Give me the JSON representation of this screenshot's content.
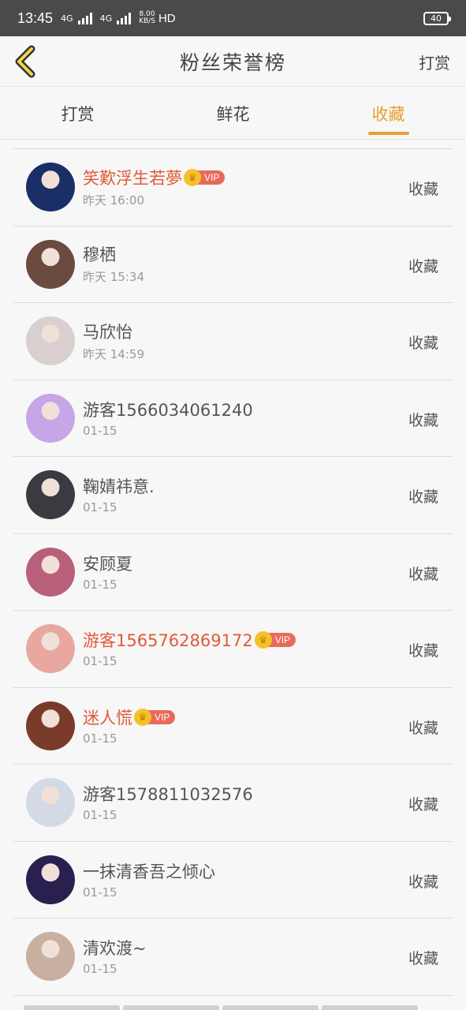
{
  "status_bar": {
    "time": "13:45",
    "network_1": "4G",
    "network_2": "4G",
    "speed_value": "8.00",
    "speed_unit": "KB/S",
    "hd": "HD",
    "battery": "40"
  },
  "nav": {
    "title": "粉丝荣誉榜",
    "right_label": "打赏"
  },
  "tabs": [
    {
      "label": "打赏",
      "active": false
    },
    {
      "label": "鲜花",
      "active": false
    },
    {
      "label": "收藏",
      "active": true
    }
  ],
  "vip_label": "VIP",
  "fans": [
    {
      "name": "笑歎浮生若夢",
      "time": "昨天 16:00",
      "action": "收藏",
      "vip": true,
      "avatar_color": "#1a2f66"
    },
    {
      "name": "穆栖",
      "time": "昨天 15:34",
      "action": "收藏",
      "vip": false,
      "avatar_color": "#6b4a40"
    },
    {
      "name": "马欣怡",
      "time": "昨天 14:59",
      "action": "收藏",
      "vip": false,
      "avatar_color": "#d9cfcf"
    },
    {
      "name": "游客1566034061240",
      "time": "01-15",
      "action": "收藏",
      "vip": false,
      "avatar_color": "#c6a6e6"
    },
    {
      "name": "鞠婧祎意.",
      "time": "01-15",
      "action": "收藏",
      "vip": false,
      "avatar_color": "#3a3a40"
    },
    {
      "name": "安顾夏",
      "time": "01-15",
      "action": "收藏",
      "vip": false,
      "avatar_color": "#b8607a"
    },
    {
      "name": "游客1565762869172",
      "time": "01-15",
      "action": "收藏",
      "vip": true,
      "avatar_color": "#e8a8a0"
    },
    {
      "name": "迷人慌",
      "time": "01-15",
      "action": "收藏",
      "vip": true,
      "avatar_color": "#7a3a2a"
    },
    {
      "name": "游客1578811032576",
      "time": "01-15",
      "action": "收藏",
      "vip": false,
      "avatar_color": "#d4d9e6"
    },
    {
      "name": "一抹清香吾之倾心",
      "time": "01-15",
      "action": "收藏",
      "vip": false,
      "avatar_color": "#2a2050"
    },
    {
      "name": "清欢渡~",
      "time": "01-15",
      "action": "收藏",
      "vip": false,
      "avatar_color": "#c8b0a0"
    }
  ],
  "colors": {
    "accent": "#e8a030",
    "vip_name": "#e05a3a",
    "vip_tag": "#e86a5a",
    "status_bar": "#4a4a4a"
  }
}
